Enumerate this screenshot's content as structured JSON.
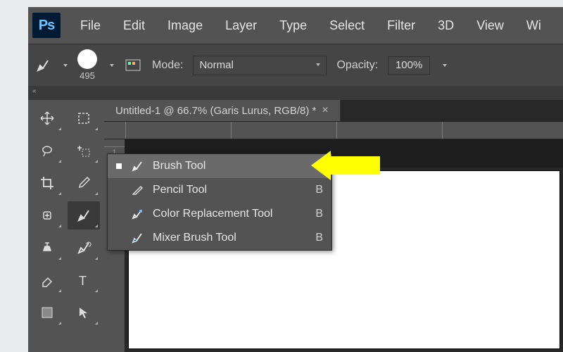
{
  "logo": "Ps",
  "menu": [
    "File",
    "Edit",
    "Image",
    "Layer",
    "Type",
    "Select",
    "Filter",
    "3D",
    "View",
    "Wi"
  ],
  "options": {
    "brush_size": "495",
    "mode_label": "Mode:",
    "mode_value": "Normal",
    "opacity_label": "Opacity:",
    "opacity_value": "100%"
  },
  "collapse_chevrons": "«",
  "doc_tab": {
    "title": "Untitled-1 @ 66.7% (Garis Lurus, RGB/8) *",
    "close": "×"
  },
  "ruler_h_ticks": [
    {
      "pos": 10,
      "label": ""
    },
    {
      "pos": 150,
      "label": ""
    },
    {
      "pos": 300,
      "label": ""
    },
    {
      "pos": 450,
      "label": ""
    }
  ],
  "ruler_v_label": "1",
  "flyout": [
    {
      "label": "Brush Tool",
      "shortcut": "",
      "selected": true,
      "icon": "brush"
    },
    {
      "label": "Pencil Tool",
      "shortcut": "B",
      "selected": false,
      "icon": "pencil"
    },
    {
      "label": "Color Replacement Tool",
      "shortcut": "B",
      "selected": false,
      "icon": "colorrep"
    },
    {
      "label": "Mixer Brush Tool",
      "shortcut": "B",
      "selected": false,
      "icon": "mixer"
    }
  ]
}
